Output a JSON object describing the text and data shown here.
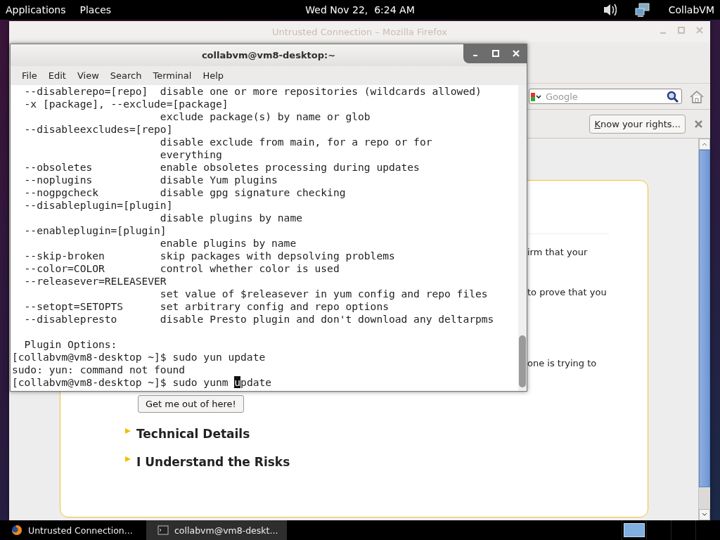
{
  "top_panel": {
    "menus": [
      "Applications",
      "Places"
    ],
    "clock": "Wed Nov 22,  6:24 AM",
    "user": "CollabVM"
  },
  "firefox": {
    "title": "Untrusted Connection – Mozilla Firefox",
    "active": false,
    "search": {
      "placeholder": "Google"
    },
    "notification": {
      "button": "Know your rights..."
    },
    "page": {
      "fragments": [
        "irm that your",
        "to prove that you",
        "one is trying to"
      ],
      "button": "Get me out of here!",
      "sections": [
        {
          "title": "Technical Details",
          "expanded": false
        },
        {
          "title": "I Understand the Risks",
          "expanded": false
        }
      ]
    }
  },
  "terminal": {
    "title": "collabvm@vm8-desktop:~",
    "active": true,
    "menu": [
      "File",
      "Edit",
      "View",
      "Search",
      "Terminal",
      "Help"
    ],
    "lines": [
      "  --disablerepo=[repo]  disable one or more repositories (wildcards allowed)",
      "  -x [package], --exclude=[package]",
      "                        exclude package(s) by name or glob",
      "  --disableexcludes=[repo]",
      "                        disable exclude from main, for a repo or for",
      "                        everything",
      "  --obsoletes           enable obsoletes processing during updates",
      "  --noplugins           disable Yum plugins",
      "  --nogpgcheck          disable gpg signature checking",
      "  --disableplugin=[plugin]",
      "                        disable plugins by name",
      "  --enableplugin=[plugin]",
      "                        enable plugins by name",
      "  --skip-broken         skip packages with depsolving problems",
      "  --color=COLOR         control whether color is used",
      "  --releasever=RELEASEVER",
      "                        set value of $releasever in yum config and repo files",
      "  --setopt=SETOPTS      set arbitrary config and repo options",
      "  --disablepresto       disable Presto plugin and don't download any deltarpms"
    ],
    "session_lines": [
      "  Plugin Options:",
      "[collabvm@vm8-desktop ~]$ sudo yun update",
      "sudo: yun: command not found"
    ],
    "input_line": {
      "before": "[collabvm@vm8-desktop ~]$ sudo yunm ",
      "cursor": "u",
      "after": "pdate"
    }
  },
  "taskbar": {
    "items": [
      {
        "label": "Untrusted Connection...",
        "kind": "browser",
        "selected": false
      },
      {
        "label": "collabvm@vm8-deskt...",
        "kind": "terminal",
        "selected": true
      }
    ]
  }
}
